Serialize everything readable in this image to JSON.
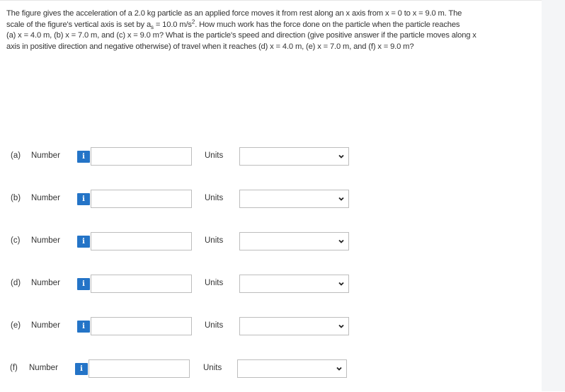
{
  "question": {
    "line1": "The figure gives the acceleration of a 2.0 kg particle as an applied force moves it from rest along an x axis from x = 0 to x = 9.0 m. The",
    "line2_pre": "scale of the figure's vertical axis is set by a",
    "line2_sub": "s",
    "line2_mid": " = 10.0 m/s",
    "line2_sup": "2",
    "line2_post": ". How much work has the force done on the particle when the particle reaches",
    "line3": "(a) x = 4.0 m, (b) x = 7.0 m, and (c) x = 9.0 m? What is the particle's speed and direction (give positive answer if the particle moves along x",
    "line4": "axis in positive direction and negative otherwise) of travel when it reaches (d) x = 4.0 m, (e) x = 7.0 m, and (f) x = 9.0 m?"
  },
  "answer_rows": [
    {
      "part": "(a)",
      "number_label": "Number",
      "info_icon": "i",
      "number_value": "",
      "units_label": "Units",
      "units_value": ""
    },
    {
      "part": "(b)",
      "number_label": "Number",
      "info_icon": "i",
      "number_value": "",
      "units_label": "Units",
      "units_value": ""
    },
    {
      "part": "(c)",
      "number_label": "Number",
      "info_icon": "i",
      "number_value": "",
      "units_label": "Units",
      "units_value": ""
    },
    {
      "part": "(d)",
      "number_label": "Number",
      "info_icon": "i",
      "number_value": "",
      "units_label": "Units",
      "units_value": ""
    },
    {
      "part": "(e)",
      "number_label": "Number",
      "info_icon": "i",
      "number_value": "",
      "units_label": "Units",
      "units_value": ""
    },
    {
      "part": "(f)",
      "number_label": "Number",
      "info_icon": "i",
      "number_value": "",
      "units_label": "Units",
      "units_value": ""
    }
  ],
  "colors": {
    "info_button": "#2474c7",
    "border": "#bdbdbd",
    "text": "#333333"
  }
}
